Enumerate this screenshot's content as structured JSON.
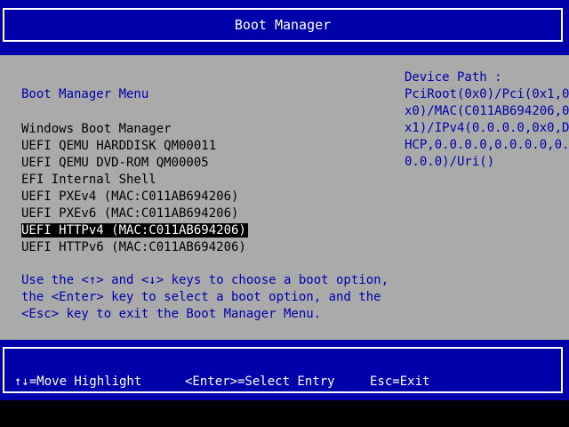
{
  "header": {
    "title": "Boot Manager"
  },
  "menu": {
    "title": "Boot Manager Menu",
    "items": [
      {
        "label": "Windows Boot Manager"
      },
      {
        "label": "UEFI QEMU HARDDISK QM00011"
      },
      {
        "label": "UEFI QEMU DVD-ROM QM00005"
      },
      {
        "label": "EFI Internal Shell"
      },
      {
        "label": "UEFI PXEv4 (MAC:C011AB694206)"
      },
      {
        "label": "UEFI PXEv6 (MAC:C011AB694206)"
      },
      {
        "label": "UEFI HTTPv4 (MAC:C011AB694206)"
      },
      {
        "label": "UEFI HTTPv6 (MAC:C011AB694206)"
      }
    ],
    "selected_index": 6
  },
  "help": {
    "lines": [
      "Use the <↑> and <↓> keys to choose a boot option,",
      "the <Enter> key to select a boot option, and the",
      "<Esc> key to exit the Boot Manager Menu."
    ]
  },
  "device_path": {
    "label": "Device Path :",
    "lines": [
      "PciRoot(0x0)/Pci(0x1,0",
      "x0)/MAC(C011AB694206,0",
      "x1)/IPv4(0.0.0.0,0x0,D",
      "HCP,0.0.0.0,0.0.0.0,0.",
      "0.0.0)/Uri()"
    ]
  },
  "footer": {
    "move_hint": "↑↓=Move Highlight",
    "enter_hint": "<Enter>=Select Entry",
    "esc_hint": "Esc=Exit"
  },
  "colors": {
    "header_footer_bg": "#0000aa",
    "main_bg": "#aaaaaa",
    "accent_text": "#0000aa",
    "selection_bg": "#000000",
    "selection_fg": "#ffffff"
  }
}
